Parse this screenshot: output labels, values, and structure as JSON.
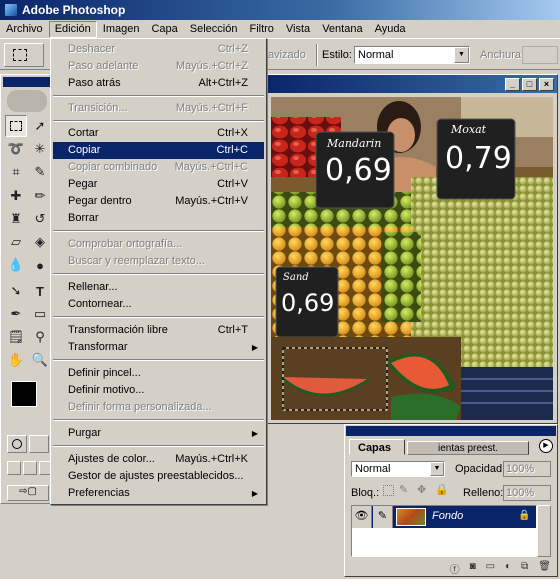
{
  "app": {
    "title": "Adobe Photoshop"
  },
  "menubar": [
    {
      "label": "Archivo"
    },
    {
      "label": "Edición"
    },
    {
      "label": "Imagen"
    },
    {
      "label": "Capa"
    },
    {
      "label": "Selección"
    },
    {
      "label": "Filtro"
    },
    {
      "label": "Vista"
    },
    {
      "label": "Ventana"
    },
    {
      "label": "Ayuda"
    }
  ],
  "options_bar": {
    "antialias_fragment": "avizado",
    "estilo_label": "Estilo:",
    "estilo_value": "Normal",
    "anchura_label": "Anchura"
  },
  "edit_menu": {
    "items": [
      {
        "label": "Deshacer",
        "shortcut": "Ctrl+Z",
        "disabled": true
      },
      {
        "label": "Paso adelante",
        "shortcut": "Mayús.+Ctrl+Z",
        "disabled": true
      },
      {
        "label": "Paso atrás",
        "shortcut": "Alt+Ctrl+Z",
        "disabled": false
      },
      {
        "label": "Transición...",
        "shortcut": "Mayús.+Ctrl+F",
        "disabled": true
      },
      {
        "label": "Cortar",
        "shortcut": "Ctrl+X",
        "disabled": false
      },
      {
        "label": "Copiar",
        "shortcut": "Ctrl+C",
        "disabled": false,
        "highlighted": true
      },
      {
        "label": "Copiar combinado",
        "shortcut": "Mayús.+Ctrl+C",
        "disabled": true
      },
      {
        "label": "Pegar",
        "shortcut": "Ctrl+V",
        "disabled": false
      },
      {
        "label": "Pegar dentro",
        "shortcut": "Mayús.+Ctrl+V",
        "disabled": false
      },
      {
        "label": "Borrar",
        "shortcut": "",
        "disabled": false
      },
      {
        "label": "Comprobar ortografía...",
        "shortcut": "",
        "disabled": true
      },
      {
        "label": "Buscar y reemplazar texto...",
        "shortcut": "",
        "disabled": true
      },
      {
        "label": "Rellenar...",
        "shortcut": "",
        "disabled": false
      },
      {
        "label": "Contornear...",
        "shortcut": "",
        "disabled": false
      },
      {
        "label": "Transformación libre",
        "shortcut": "Ctrl+T",
        "disabled": false
      },
      {
        "label": "Transformar",
        "shortcut": "",
        "disabled": false,
        "submenu": true
      },
      {
        "label": "Definir pincel...",
        "shortcut": "",
        "disabled": false
      },
      {
        "label": "Definir motivo...",
        "shortcut": "",
        "disabled": false
      },
      {
        "label": "Definir forma personalizada...",
        "shortcut": "",
        "disabled": true
      },
      {
        "label": "Purgar",
        "shortcut": "",
        "disabled": false,
        "submenu": true
      },
      {
        "label": "Ajustes de color...",
        "shortcut": "Mayús.+Ctrl+K",
        "disabled": false
      },
      {
        "label": "Gestor de ajustes preestablecidos...",
        "shortcut": "",
        "disabled": false
      },
      {
        "label": "Preferencias",
        "shortcut": "",
        "disabled": false,
        "submenu": true
      }
    ]
  },
  "canvas_signs": {
    "mandarina_name": "Mandarin",
    "mandarina_price": "0,69",
    "moscatel_name": "Moxat",
    "moscatel_price": "0,79",
    "sandia_name": "Sand",
    "sandia_price": "0,69"
  },
  "layers_palette": {
    "tab_active": "Capas",
    "tab_inactive": "ientas preest.",
    "blend_mode": "Normal",
    "opacity_label": "Opacidad:",
    "opacity_value": "100%",
    "lock_label": "Bloq.:",
    "fill_label": "Relleno:",
    "fill_value": "100%",
    "layer_name": "Fondo"
  },
  "colors": {
    "titlebar": "#0a246a",
    "menu_highlight": "#0a246a",
    "chrome": "#d4d0c8"
  }
}
